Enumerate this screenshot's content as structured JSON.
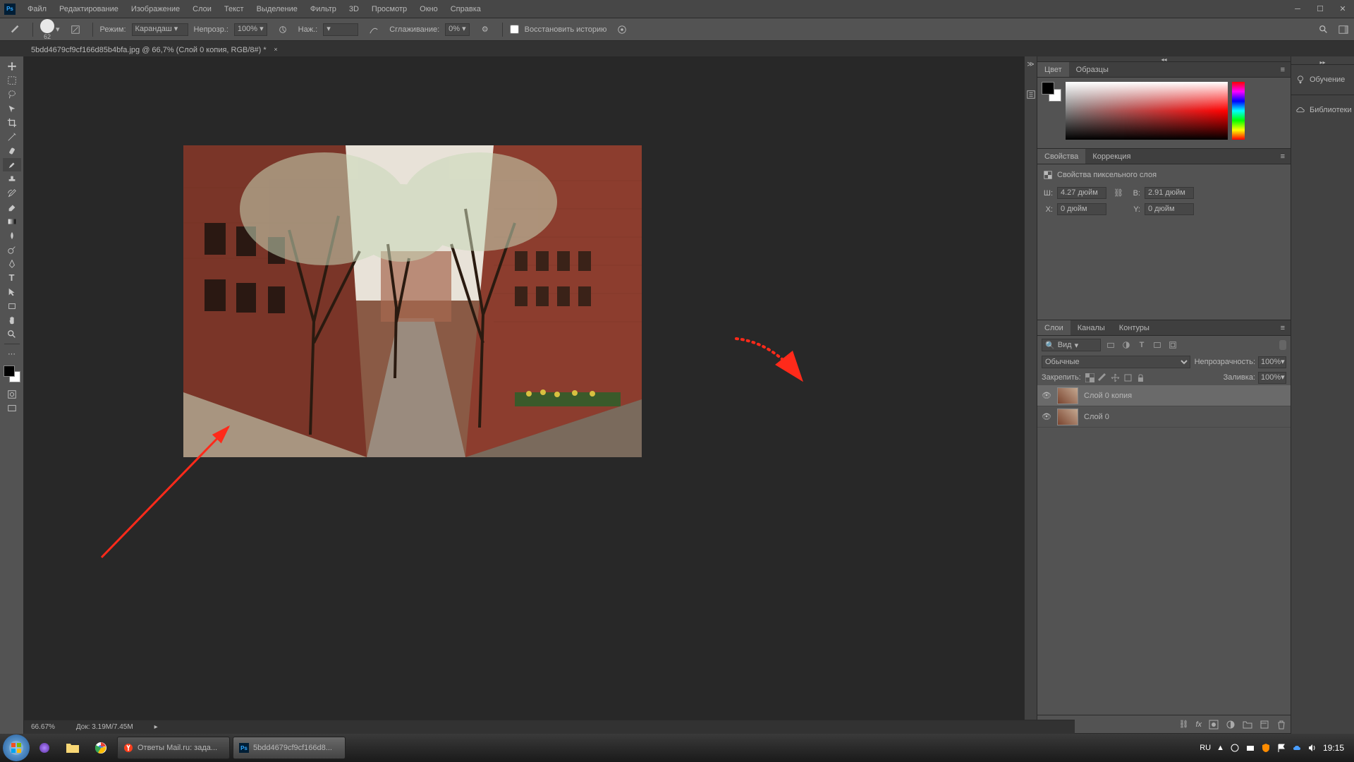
{
  "menu": {
    "items": [
      "Файл",
      "Редактирование",
      "Изображение",
      "Слои",
      "Текст",
      "Выделение",
      "Фильтр",
      "3D",
      "Просмотр",
      "Окно",
      "Справка"
    ]
  },
  "optbar": {
    "brush_size": "62",
    "mode_lbl": "Режим:",
    "mode_val": "Карандаш",
    "opacity_lbl": "Непрозр.:",
    "opacity_val": "100%",
    "pressure_lbl": "Наж.:",
    "smoothing_lbl": "Сглаживание:",
    "smoothing_val": "0%",
    "restore_lbl": "Восстановить историю"
  },
  "tab": {
    "title": "5bdd4679cf9cf166d85b4bfa.jpg @ 66,7% (Слой 0 копия, RGB/8#) *"
  },
  "status": {
    "zoom": "66.67%",
    "doc": "Док: 3.19M/7.45M"
  },
  "panels": {
    "color_tabs": [
      "Цвет",
      "Образцы"
    ],
    "prop_tabs": [
      "Свойства",
      "Коррекция"
    ],
    "prop_title": "Свойства пиксельного слоя",
    "prop": {
      "w_lbl": "Ш:",
      "w": "4.27 дюйм",
      "h_lbl": "В:",
      "h": "2.91 дюйм",
      "x_lbl": "X:",
      "x": "0 дюйм",
      "y_lbl": "Y:",
      "y": "0 дюйм"
    },
    "layer_tabs": [
      "Слои",
      "Каналы",
      "Контуры"
    ],
    "layer_filter": "Вид",
    "blend": "Обычные",
    "opacity_lbl": "Непрозрачность:",
    "opacity": "100%",
    "lock_lbl": "Закрепить:",
    "fill_lbl": "Заливка:",
    "fill": "100%",
    "layers": [
      {
        "name": "Слой 0 копия",
        "sel": true
      },
      {
        "name": "Слой 0",
        "sel": false
      }
    ]
  },
  "collapse": {
    "learn": "Обучение",
    "lib": "Библиотеки"
  },
  "taskbar": {
    "items": [
      {
        "label": "Ответы Mail.ru: зада..."
      },
      {
        "label": "5bdd4679cf9cf166d8...",
        "active": true
      }
    ],
    "lang": "RU",
    "time": "19:15"
  }
}
